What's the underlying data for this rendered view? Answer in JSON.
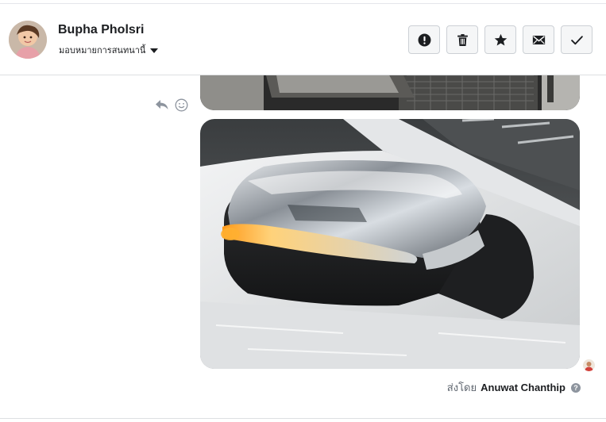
{
  "contact": {
    "name": "Bupha Pholsri",
    "assign_label": "มอบหมายการสนทนานี้"
  },
  "actions": [
    {
      "name": "mark-spam-button",
      "icon": "alert-icon"
    },
    {
      "name": "delete-button",
      "icon": "trash-icon"
    },
    {
      "name": "star-button",
      "icon": "star-icon"
    },
    {
      "name": "mark-unread-button",
      "icon": "envelope-icon"
    },
    {
      "name": "mark-done-button",
      "icon": "check-icon"
    }
  ],
  "message": {
    "sent_by_prefix": "ส่งโดย",
    "sent_by_name": "Anuwat Chanthip",
    "help_glyph": "?"
  },
  "colors": {
    "icon": "#1c1e21",
    "muted_icon": "#8d949e",
    "border": "#ccd0d5"
  }
}
